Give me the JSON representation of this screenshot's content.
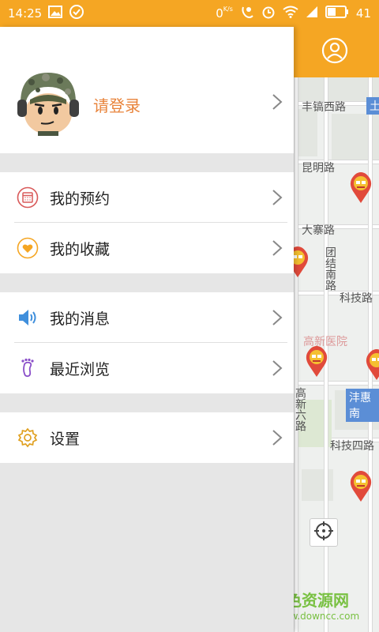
{
  "status_bar": {
    "time": "14:25",
    "net_speed": "0",
    "net_unit": "K/s",
    "battery": "41"
  },
  "drawer": {
    "login_label": "请登录",
    "menu_groups": [
      [
        {
          "label": "我的预约",
          "icon": "calendar-icon"
        },
        {
          "label": "我的收藏",
          "icon": "heart-icon"
        }
      ],
      [
        {
          "label": "我的消息",
          "icon": "speaker-icon"
        },
        {
          "label": "最近浏览",
          "icon": "footprint-icon"
        }
      ],
      [
        {
          "label": "设置",
          "icon": "gear-icon"
        }
      ]
    ]
  },
  "map": {
    "labels": {
      "fenghao": "丰镐西路",
      "fenghao_tag": "土",
      "kunming": "昆明路",
      "dazhai": "大寨路",
      "tuanjie": "团结南路",
      "keji": "科技路",
      "hospital": "高新医院",
      "fenghui": "沣惠南",
      "gaoxin6": "高新六路",
      "keji4": "科技四路"
    }
  },
  "watermark": {
    "title": "绿色资源网",
    "url": "www.downcc.com"
  },
  "colors": {
    "accent": "#f5a623",
    "login_text": "#e8833a",
    "calendar": "#d95a5a",
    "heart": "#f5a623",
    "speaker": "#3f8fdc",
    "footprint": "#8a4fc9",
    "gear": "#e0a020"
  }
}
